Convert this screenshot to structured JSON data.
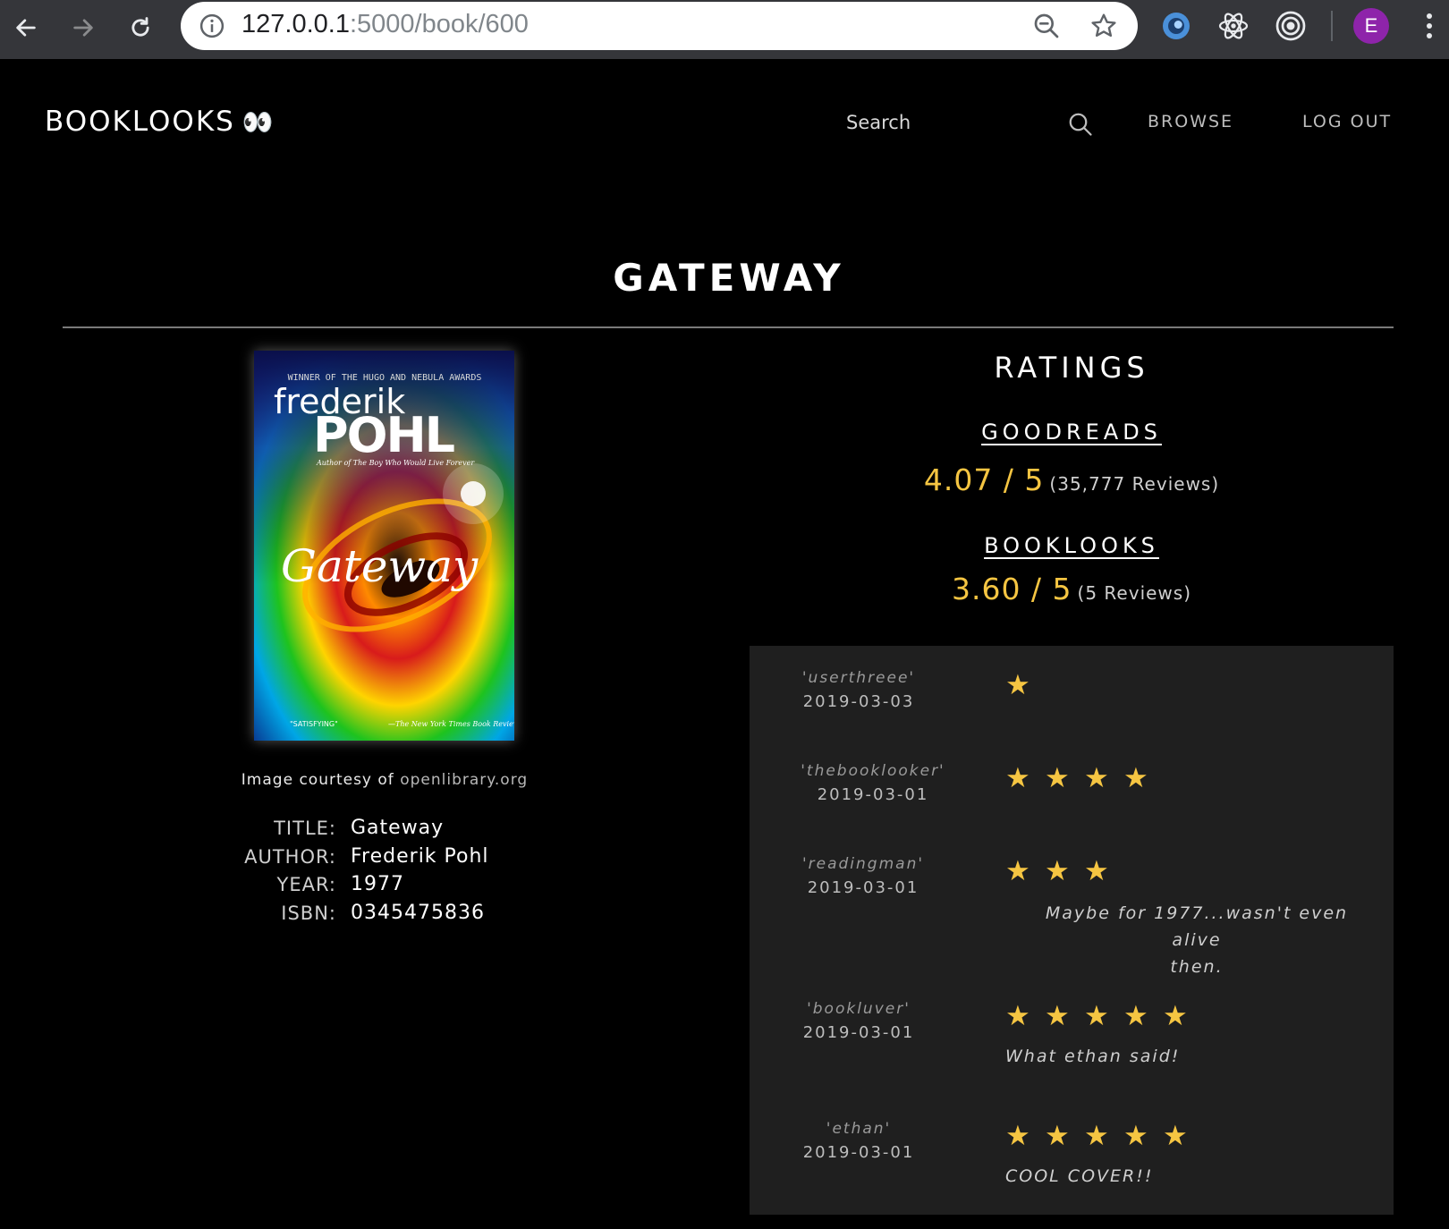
{
  "browser": {
    "url_host": "127.0.0.1",
    "url_path": ":5000/book/600",
    "profile_initial": "E"
  },
  "nav": {
    "brand": "BOOKLOOKS",
    "brand_emoji": "👀",
    "search_placeholder": "Search",
    "browse": "BROWSE",
    "logout": "LOG OUT"
  },
  "book": {
    "heading": "GATEWAY",
    "cover": {
      "award_line": "WINNER OF THE HUGO AND NEBULA AWARDS",
      "author_first": "frederik",
      "author_last": "POHL",
      "tagline": "Author of The Boy Who Would Live Forever",
      "title": "Gateway",
      "blurb": "\"SATISFYING\"",
      "source": "—The New York Times Book Review"
    },
    "courtesy_prefix": "Image courtesy of",
    "courtesy_link": "openlibrary.org",
    "details": [
      {
        "label": "TITLE:",
        "value": "Gateway"
      },
      {
        "label": "AUTHOR:",
        "value": "Frederik Pohl"
      },
      {
        "label": "YEAR:",
        "value": "1977"
      },
      {
        "label": "ISBN:",
        "value": "0345475836"
      }
    ]
  },
  "ratings": {
    "heading": "RATINGS",
    "sources": [
      {
        "name": "GOODREADS",
        "score": "4.07 / 5",
        "count": "(35,777 Reviews)"
      },
      {
        "name": "BOOKLOOKS",
        "score": "3.60 / 5",
        "count": "(5 Reviews)"
      }
    ]
  },
  "reviews": [
    {
      "user": "'userthreee'",
      "date": "2019-03-03",
      "stars": 1,
      "text": ""
    },
    {
      "user": "'thebooklooker'",
      "date": "2019-03-01",
      "stars": 4,
      "text": ""
    },
    {
      "user": "'readingman'",
      "date": "2019-03-01",
      "stars": 3,
      "text_line1": "Maybe for 1977...wasn't even alive",
      "text_line2": "then."
    },
    {
      "user": "'bookluver'",
      "date": "2019-03-01",
      "stars": 5,
      "text": "What ethan said!"
    },
    {
      "user": "'ethan'",
      "date": "2019-03-01",
      "stars": 5,
      "text": "COOL COVER!!"
    }
  ],
  "colors": {
    "accent_gold": "#f5c542",
    "review_panel": "#1f1f1f",
    "chrome": "#35363a",
    "avatar": "#8e24aa"
  },
  "icons": [
    "back-arrow-icon",
    "forward-arrow-icon",
    "reload-icon",
    "info-icon",
    "zoom-icon",
    "star-bookmark-icon",
    "extension-swirl-icon",
    "react-atom-icon",
    "target-icon",
    "kebab-menu-icon",
    "search-icon",
    "star-icon"
  ]
}
